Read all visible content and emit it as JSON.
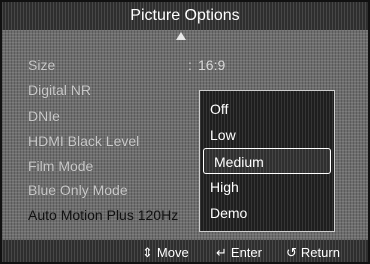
{
  "title": "Picture Options",
  "scroll_up_icon": "up-arrow-icon",
  "menu": {
    "items": [
      {
        "label": "Size",
        "value": "16:9"
      },
      {
        "label": "Digital NR",
        "value": ""
      },
      {
        "label": "DNIe",
        "value": ""
      },
      {
        "label": "HDMI Black Level",
        "value": ""
      },
      {
        "label": "Film Mode",
        "value": ""
      },
      {
        "label": "Blue Only Mode",
        "value": ""
      },
      {
        "label": "Auto Motion Plus 120Hz",
        "value": ""
      }
    ],
    "active_index": 6
  },
  "dropdown": {
    "options": [
      "Off",
      "Low",
      "Medium",
      "High",
      "Demo"
    ],
    "selected": "Medium"
  },
  "footer": {
    "move_label": "Move",
    "move_icon": "up-down-arrow-icon",
    "enter_label": "Enter",
    "enter_icon": "enter-icon",
    "return_label": "Return",
    "return_icon": "return-icon"
  }
}
